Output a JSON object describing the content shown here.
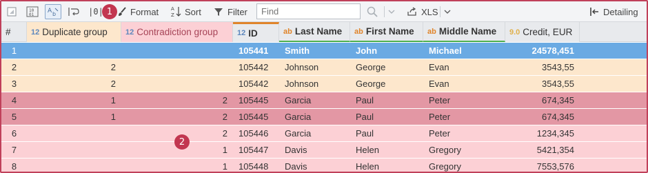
{
  "toolbar": {
    "format_label": "Format",
    "sort_label": "Sort",
    "filter_label": "Filter",
    "find_placeholder": "Find",
    "export_label": "XLS",
    "detailing_label": "Detailing",
    "column_toggle_label": "|0|"
  },
  "badges": {
    "first": "1",
    "second": "2"
  },
  "colors": {
    "selected_row": "#6aaae3",
    "duplicate_row": "#fde7cc",
    "contradiction_strong_row": "#e397a4",
    "contradiction_row": "#fcd0d5",
    "badge": "#c23650"
  },
  "grid": {
    "row_number_header": "#",
    "columns": [
      {
        "type_label": "12",
        "name": "Duplicate group"
      },
      {
        "type_label": "12",
        "name": "Contradiction group"
      },
      {
        "type_label": "12",
        "name": "ID"
      },
      {
        "type_label": "ab",
        "name": "Last Name"
      },
      {
        "type_label": "ab",
        "name": "First Name"
      },
      {
        "type_label": "ab",
        "name": "Middle Name"
      },
      {
        "type_label": "9.0",
        "name": "Credit, EUR"
      }
    ],
    "rows": [
      {
        "num": "1",
        "dup": "",
        "con": "",
        "id": "105441",
        "last": "Smith",
        "first": "John",
        "middle": "Michael",
        "credit": "24578,451",
        "state": "selected"
      },
      {
        "num": "2",
        "dup": "2",
        "con": "",
        "id": "105442",
        "last": "Johnson",
        "first": "George",
        "middle": "Evan",
        "credit": "3543,55",
        "state": "duplicate"
      },
      {
        "num": "3",
        "dup": "2",
        "con": "",
        "id": "105442",
        "last": "Johnson",
        "first": "George",
        "middle": "Evan",
        "credit": "3543,55",
        "state": "duplicate"
      },
      {
        "num": "4",
        "dup": "1",
        "con": "2",
        "id": "105445",
        "last": "Garcia",
        "first": "Paul",
        "middle": "Peter",
        "credit": "674,345",
        "state": "contradiction-strong"
      },
      {
        "num": "5",
        "dup": "1",
        "con": "2",
        "id": "105445",
        "last": "Garcia",
        "first": "Paul",
        "middle": "Peter",
        "credit": "674,345",
        "state": "contradiction-strong"
      },
      {
        "num": "6",
        "dup": "",
        "con": "2",
        "id": "105446",
        "last": "Garcia",
        "first": "Paul",
        "middle": "Peter",
        "credit": "1234,345",
        "state": "contradiction"
      },
      {
        "num": "7",
        "dup": "",
        "con": "1",
        "id": "105447",
        "last": "Davis",
        "first": "Helen",
        "middle": "Gregory",
        "credit": "5421,354",
        "state": "contradiction"
      },
      {
        "num": "8",
        "dup": "",
        "con": "1",
        "id": "105448",
        "last": "Davis",
        "first": "Helen",
        "middle": "Gregory",
        "credit": "7553,576",
        "state": "contradiction"
      }
    ]
  }
}
